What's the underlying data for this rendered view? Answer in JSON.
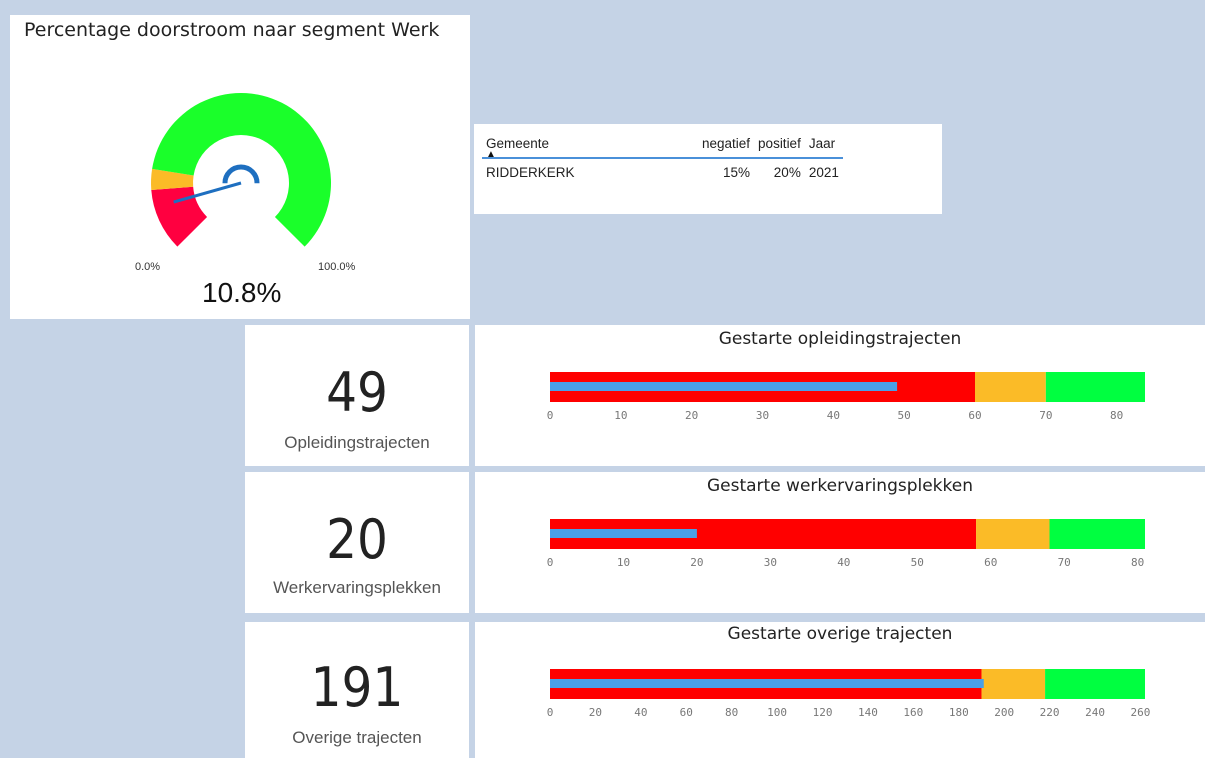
{
  "gauge": {
    "title": "Percentage doorstroom naar segment Werk",
    "min_label": "0.0%",
    "max_label": "100.0%",
    "value_label": "10.8%",
    "value": 10.8,
    "min": 0,
    "max": 100,
    "bands": [
      {
        "from": 0,
        "to": 15,
        "color": "#ff0040"
      },
      {
        "from": 15,
        "to": 20,
        "color": "#fbbb27"
      },
      {
        "from": 20,
        "to": 100,
        "color": "#1aff2a"
      }
    ],
    "needle_color": "#1e6fc0"
  },
  "table": {
    "columns": [
      "Gemeente",
      "negatief",
      "positief",
      "Jaar"
    ],
    "rows": [
      [
        "RIDDERKERK",
        "15%",
        "20%",
        "2021"
      ]
    ],
    "sort_icon": "sort-ascending-icon"
  },
  "kpis": [
    {
      "value": "49",
      "label": "Opleidingstrajecten"
    },
    {
      "value": "20",
      "label": "Werkervaringsplekken"
    },
    {
      "value": "191",
      "label": "Overige trajecten"
    }
  ],
  "chart_data": [
    {
      "type": "bar",
      "title": "Gestarte opleidingstrajecten",
      "value": 49,
      "xlim": [
        0,
        84
      ],
      "ticks": [
        0,
        10,
        20,
        30,
        40,
        50,
        60,
        70,
        80
      ],
      "bands": [
        {
          "from": 0,
          "to": 60,
          "color": "#ff0000"
        },
        {
          "from": 60,
          "to": 70,
          "color": "#fbbb27"
        },
        {
          "from": 70,
          "to": 84,
          "color": "#00ff40"
        }
      ],
      "bar_color": "#4a9fe8"
    },
    {
      "type": "bar",
      "title": "Gestarte werkervaringsplekken",
      "value": 20,
      "xlim": [
        0,
        81
      ],
      "ticks": [
        0,
        10,
        20,
        30,
        40,
        50,
        60,
        70,
        80
      ],
      "bands": [
        {
          "from": 0,
          "to": 58,
          "color": "#ff0000"
        },
        {
          "from": 58,
          "to": 68,
          "color": "#fbbb27"
        },
        {
          "from": 68,
          "to": 81,
          "color": "#00ff40"
        }
      ],
      "bar_color": "#4a9fe8"
    },
    {
      "type": "bar",
      "title": "Gestarte overige trajecten",
      "value": 191,
      "xlim": [
        0,
        262
      ],
      "ticks": [
        0,
        20,
        40,
        60,
        80,
        100,
        120,
        140,
        160,
        180,
        200,
        220,
        240,
        260
      ],
      "bands": [
        {
          "from": 0,
          "to": 190,
          "color": "#ff0000"
        },
        {
          "from": 190,
          "to": 218,
          "color": "#fbbb27"
        },
        {
          "from": 218,
          "to": 262,
          "color": "#00ff40"
        }
      ],
      "bar_color": "#4a9fe8"
    }
  ]
}
